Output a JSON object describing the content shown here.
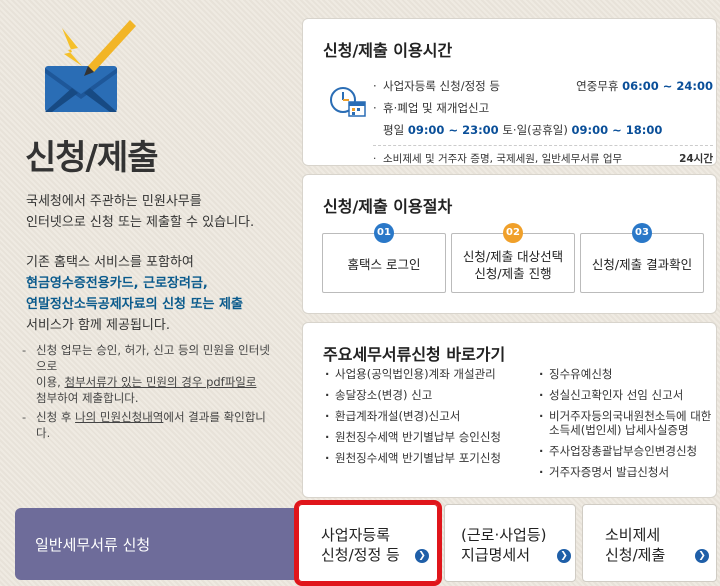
{
  "left": {
    "title": "신청/제출",
    "desc_line1": "국세청에서 주관하는 민원사무를",
    "desc_line2": "인터넷으로 신청 또는 제출할 수 있습니다.",
    "desc2_line1": "기존 홈택스 서비스를 포함하여",
    "desc2_hl1": "현금영수증전용카드, 근로장려금,",
    "desc2_hl2": "연말정산소득공제자료의 신청 또는 제출",
    "desc2_line4": "서비스가 함께 제공됩니다.",
    "note1_a": "신청 업무는 승인, 허가, 신고 등의 민원을 인터넷으로",
    "note1_b": "이용, ",
    "note1_u": "첨부서류가 있는 민원의 경우 pdf파일로",
    "note1_c": "첨부하여 제출합니다.",
    "note2_a": "신청 후 ",
    "note2_u": "나의 민원신청내역",
    "note2_b": "에서 결과를 확인합니다.",
    "bottom_label": "일반세무서류 신청"
  },
  "hours": {
    "title": "신청/제출 이용시간",
    "row1_label": "사업자등록 신청/정정 등",
    "row1_prefix": "연중무휴",
    "row1_time": "06:00 ~ 24:00",
    "row2_label": "휴·폐업 및 재개업신고",
    "row3_p1": "평일",
    "row3_t1": "09:00 ~ 23:00",
    "row3_p2": "토·일(공휴일)",
    "row3_t2": "09:00 ~ 18:00",
    "row4_label": "소비제세 및 거주자 증명, 국제세원, 일반세무서류 업무",
    "row4_time": "24시간"
  },
  "procedure": {
    "title": "신청/제출 이용절차",
    "steps": [
      {
        "num": "01",
        "line1": "홈택스 로그인",
        "line2": ""
      },
      {
        "num": "02",
        "line1": "신청/제출 대상선택",
        "line2": "신청/제출 진행"
      },
      {
        "num": "03",
        "line1": "신청/제출 결과확인",
        "line2": ""
      }
    ]
  },
  "shortcuts": {
    "title": "주요세무서류신청 바로가기",
    "col_a": [
      "사업용(공익법인용)계좌 개설관리",
      "송달장소(변경) 신고",
      "환급계좌개설(변경)신고서",
      "원천징수세액 반기별납부 승인신청",
      "원천징수세액 반기별납부 포기신청"
    ],
    "col_b": [
      "징수유예신청",
      "성실신고확인자 선임 신고서",
      "비거주자등의국내원천소득에 대한 소득세(법인세) 납세사실증명",
      "주사업장총괄납부승인변경신청",
      "거주자증명서 발급신청서"
    ]
  },
  "bottom_buttons": [
    {
      "line1": "사업자등록",
      "line2": "신청/정정 등"
    },
    {
      "line1": "(근로·사업등)",
      "line2": "지급명세서"
    },
    {
      "line1": "소비제세",
      "line2": "신청/제출"
    }
  ],
  "colors": {
    "accent_blue": "#0a4f99",
    "highlight_red": "#e0151b",
    "bottom_left_bg": "#6e6c9a"
  },
  "icons": [
    "envelope-pencil-icon",
    "clock-calendar-icon",
    "arrow-right-icon"
  ]
}
